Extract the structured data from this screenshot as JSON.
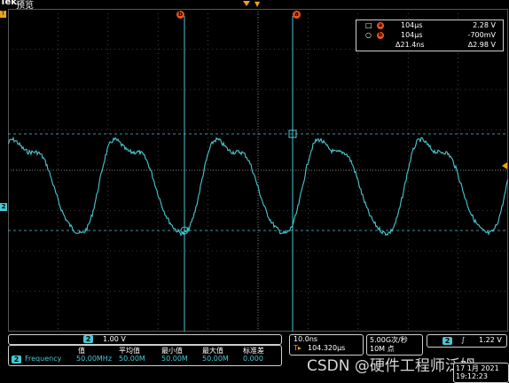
{
  "topbar": {
    "brand": "Tek",
    "mode": "预览"
  },
  "cursors": {
    "a_label": "a",
    "b_label": "b"
  },
  "readout": {
    "row1": {
      "symbol": "□",
      "tag": "a",
      "time": "104µs",
      "value": "2.28 V"
    },
    "row2": {
      "symbol": "○",
      "tag": "b",
      "time": "104µs",
      "value": "-700mV"
    },
    "row3": {
      "symbol": "",
      "delta_time": "Δ21.4ns",
      "delta_value": "Δ2.98 V"
    }
  },
  "channel": {
    "marker": "2",
    "scale": "1.00 V",
    "measure_label": "Frequency",
    "headers": {
      "value": "值",
      "mean": "平均值",
      "min": "最小值",
      "max": "最大值",
      "std": "标准差"
    },
    "values": {
      "value": "50.00MHz",
      "mean": "50.00M",
      "min": "50.00M",
      "max": "50.00M",
      "std": "0.000"
    }
  },
  "timebase": {
    "scale": "10.0ns",
    "position": "104.320µs",
    "sample_rate": "5.00G次/秒",
    "record": "10M 点"
  },
  "trigger": {
    "source": "2",
    "slope": "∫",
    "level": "1.22 V"
  },
  "clock": {
    "date": "17 1月 2021",
    "time": "19:12:23"
  },
  "watermark": "CSDN @硬件工程师泛姆",
  "colors": {
    "trace": "#48c8d2",
    "cursor": "#e8541d",
    "grid": "#6e6e6e"
  }
}
